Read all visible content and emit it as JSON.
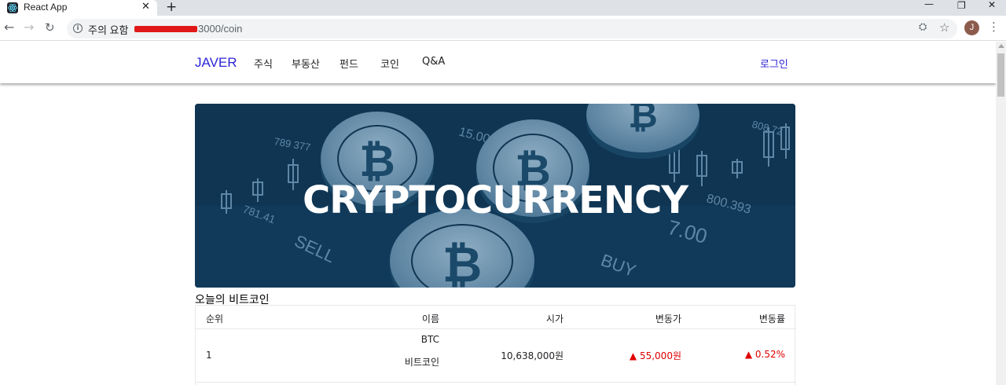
{
  "browser": {
    "tab_title": "React App",
    "tab_close": "✕",
    "new_tab": "+",
    "security_label": "주의 요함",
    "url_suffix": "3000/coin",
    "avatar_letter": "J"
  },
  "navbar": {
    "brand": "JAVER",
    "menu": [
      "주식",
      "부동산",
      "펀드",
      "코인",
      "Q&A"
    ],
    "login": "로그인"
  },
  "hero": {
    "title": "CRYPTOCURRENCY",
    "decor_numbers": [
      "15.00",
      "789 377",
      "781.41",
      "800.393",
      "808.72",
      "7.00",
      "SELL",
      "BUY"
    ]
  },
  "section": {
    "title": "오늘의 비트코인"
  },
  "table": {
    "headers": [
      "순위",
      "이름",
      "시가",
      "변동가",
      "변동률"
    ],
    "rows": [
      {
        "rank": "1",
        "symbol": "BTC",
        "name": "비트코인",
        "price": "10,638,000원",
        "change": "▲ 55,000원",
        "change_rate": "▲ 0.52%"
      }
    ]
  },
  "colors": {
    "brand": "#2b24d6",
    "up": "#e00000",
    "hero_bg": "#0f3553"
  }
}
